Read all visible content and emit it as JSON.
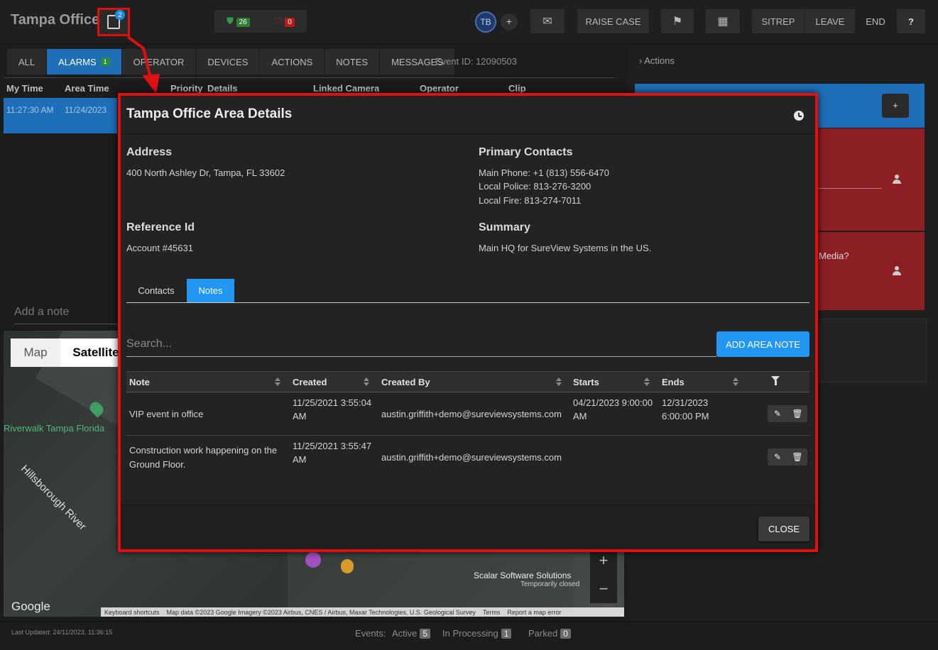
{
  "header": {
    "area_title": "Tampa Office",
    "notes_count": "2",
    "shield_count": "26",
    "heart_count": "0",
    "avatar_initials": "TB",
    "buttons": {
      "raise_case": "RAISE CASE",
      "sitrep": "SITREP",
      "leave": "LEAVE",
      "end": "END",
      "help": "?"
    }
  },
  "left_panel": {
    "tabs": [
      {
        "label": "ALL"
      },
      {
        "label": "ALARMS",
        "badge": "1"
      },
      {
        "label": "OPERATOR"
      },
      {
        "label": "DEVICES"
      },
      {
        "label": "ACTIONS"
      },
      {
        "label": "NOTES"
      },
      {
        "label": "MESSAGES"
      }
    ],
    "event_id": "Event ID: 12090503",
    "columns": [
      "My Time",
      "Area Time",
      "Priority",
      "Details",
      "Linked Camera",
      "Operator",
      "Clip"
    ],
    "alarm_row": {
      "my_time": "11:27:30 AM",
      "area_time": "11/24/2023"
    },
    "add_note_placeholder": "Add a note"
  },
  "map": {
    "toggle_map": "Map",
    "toggle_satellite": "Satellite",
    "poi_riverwalk": "Riverwalk Tampa Florida",
    "river_label": "Hillsborough River",
    "scalar": "Scalar Software Solutions",
    "scalar_status": "Temporarily closed",
    "google": "Google",
    "footer": {
      "shortcuts": "Keyboard shortcuts",
      "data": "Map data ©2023 Google Imagery ©2023 Airbus, CNES / Airbus, Maxar Technologies, U.S. Geological Survey",
      "terms": "Terms",
      "report": "Report a map error"
    },
    "zoom_in": "+",
    "zoom_out": "−"
  },
  "right_panel": {
    "header": "Actions",
    "plus": "+",
    "media_text": "Media?"
  },
  "footer": {
    "last_updated": "Last Updated: 24/11/2023, 11:36:15",
    "events_label": "Events:",
    "active_label": "Active",
    "active_count": "5",
    "processing_label": "In Processing",
    "processing_count": "1",
    "parked_label": "Parked",
    "parked_count": "0"
  },
  "modal": {
    "title": "Tampa Office Area Details",
    "address_head": "Address",
    "address": "400 North Ashley Dr, Tampa, FL 33602",
    "contacts_head": "Primary Contacts",
    "main_phone": "Main Phone: +1 (813) 556-6470",
    "local_police": "Local Police: 813-276-3200",
    "local_fire": "Local Fire: 813-274-7011",
    "ref_head": "Reference Id",
    "ref": "Account #45631",
    "summary_head": "Summary",
    "summary": "Main HQ for SureView Systems in the US.",
    "tab_contacts": "Contacts",
    "tab_notes": "Notes",
    "search_placeholder": "Search...",
    "add_note_button": "ADD AREA NOTE",
    "columns": {
      "note": "Note",
      "created": "Created",
      "created_by": "Created By",
      "starts": "Starts",
      "ends": "Ends"
    },
    "rows": [
      {
        "note": "VIP event in office",
        "created_1": "11/25/2021 3:55:04",
        "created_2": "AM",
        "created_by": "austin.griffith+demo@sureviewsystems.com",
        "starts_1": "04/21/2023 9:00:00",
        "starts_2": "AM",
        "ends_1": "12/31/2023",
        "ends_2": "6:00:00 PM"
      },
      {
        "note_1": "Construction work happening on the",
        "note_2": "Ground Floor.",
        "created_1": "11/25/2021 3:55:47",
        "created_2": "AM",
        "created_by": "austin.griffith+demo@sureviewsystems.com"
      }
    ],
    "close": "CLOSE"
  }
}
